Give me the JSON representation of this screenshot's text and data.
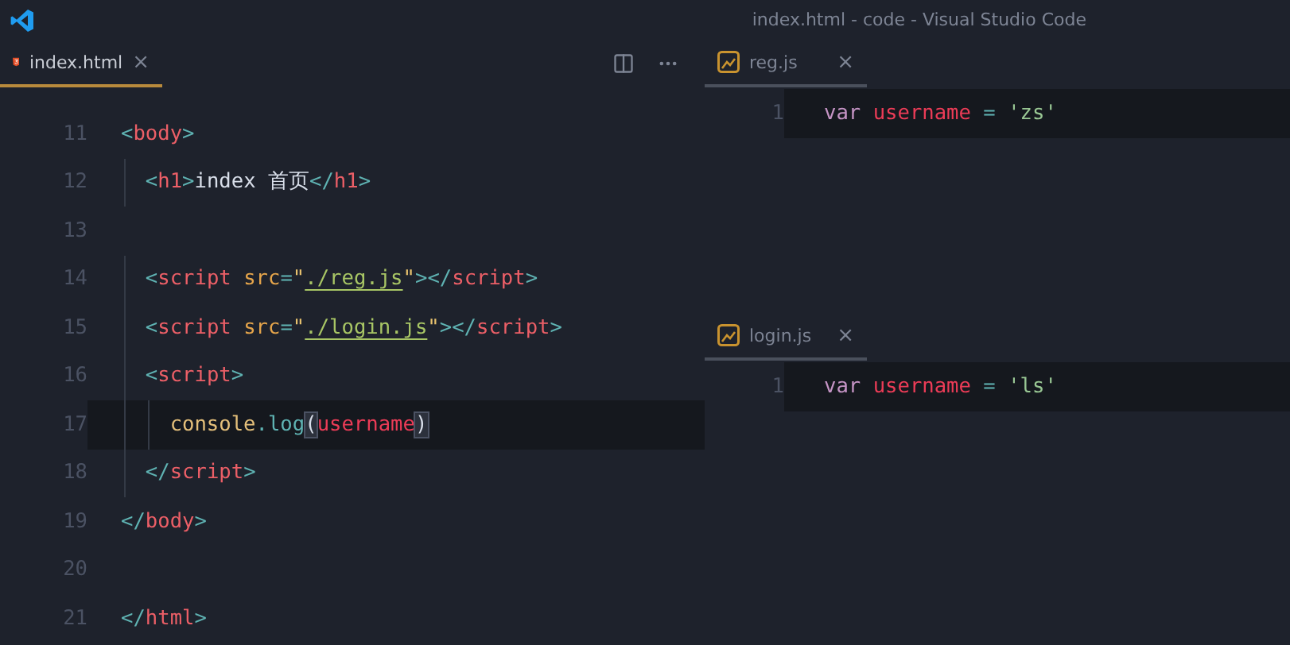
{
  "window": {
    "title": "index.html - code - Visual Studio Code"
  },
  "groups": [
    {
      "focused": true,
      "tab": {
        "label": "index.html",
        "close": "×",
        "selected": true
      },
      "lines": [
        {
          "number": "11",
          "current": false,
          "tokens": [
            {
              "kind": "bracket",
              "text": "<"
            },
            {
              "kind": "tag",
              "text": "body"
            },
            {
              "kind": "bracket",
              "text": ">"
            }
          ]
        },
        {
          "number": "12",
          "current": false,
          "tokens": [
            {
              "kind": "bracket",
              "text": "  <"
            },
            {
              "kind": "tag",
              "text": "h1"
            },
            {
              "kind": "bracket",
              "text": ">"
            },
            {
              "kind": "plain",
              "text": "index 首页"
            },
            {
              "kind": "bracket",
              "text": "</"
            },
            {
              "kind": "tag",
              "text": "h1"
            },
            {
              "kind": "bracket",
              "text": ">"
            }
          ]
        },
        {
          "number": "13",
          "current": false
        },
        {
          "number": "14",
          "current": false,
          "tokens": [
            {
              "kind": "bracket",
              "text": "  <"
            },
            {
              "kind": "tag",
              "text": "script"
            },
            {
              "kind": "attr",
              "text": " src"
            },
            {
              "kind": "bracket",
              "text": "="
            },
            {
              "kind": "quote",
              "text": "\""
            },
            {
              "kind": "link",
              "text": "./reg.js"
            },
            {
              "kind": "quote",
              "text": "\""
            },
            {
              "kind": "bracket",
              "text": "></"
            },
            {
              "kind": "tag",
              "text": "script"
            },
            {
              "kind": "bracket",
              "text": ">"
            }
          ]
        },
        {
          "number": "15",
          "current": false,
          "tokens": [
            {
              "kind": "bracket",
              "text": "  <"
            },
            {
              "kind": "tag",
              "text": "script"
            },
            {
              "kind": "attr",
              "text": " src"
            },
            {
              "kind": "bracket",
              "text": "="
            },
            {
              "kind": "quote",
              "text": "\""
            },
            {
              "kind": "link",
              "text": "./login.js"
            },
            {
              "kind": "quote",
              "text": "\""
            },
            {
              "kind": "bracket",
              "text": "></"
            },
            {
              "kind": "tag",
              "text": "script"
            },
            {
              "kind": "bracket",
              "text": ">"
            }
          ]
        },
        {
          "number": "16",
          "current": false,
          "tokens": [
            {
              "kind": "bracket",
              "text": "  <"
            },
            {
              "kind": "tag",
              "text": "script"
            },
            {
              "kind": "bracket",
              "text": ">"
            }
          ]
        },
        {
          "number": "17",
          "current": true,
          "tokens": [
            {
              "kind": "object",
              "text": "    console"
            },
            {
              "kind": "bracket",
              "text": "."
            },
            {
              "kind": "method",
              "text": "log"
            },
            {
              "kind": "paren",
              "text": "("
            },
            {
              "kind": "variable",
              "text": "username"
            },
            {
              "kind": "paren",
              "text": ")"
            }
          ]
        },
        {
          "number": "18",
          "current": false,
          "tokens": [
            {
              "kind": "bracket",
              "text": "  </"
            },
            {
              "kind": "tag",
              "text": "script"
            },
            {
              "kind": "bracket",
              "text": ">"
            }
          ]
        },
        {
          "number": "19",
          "current": false,
          "tokens": [
            {
              "kind": "bracket",
              "text": "</"
            },
            {
              "kind": "tag",
              "text": "body"
            },
            {
              "kind": "bracket",
              "text": ">"
            }
          ]
        },
        {
          "number": "20",
          "current": false
        },
        {
          "number": "21",
          "current": false,
          "tokens": [
            {
              "kind": "bracket",
              "text": "</"
            },
            {
              "kind": "tag",
              "text": "html"
            },
            {
              "kind": "bracket",
              "text": ">"
            }
          ]
        }
      ]
    },
    {
      "focused": false,
      "tab": {
        "label": "reg.js",
        "close": "×",
        "selected": true
      },
      "lines": [
        {
          "number": "1",
          "current": true,
          "tokens": [
            {
              "kind": "keyword",
              "text": "var"
            },
            {
              "kind": "variable",
              "text": " username"
            },
            {
              "kind": "bracket",
              "text": " ="
            },
            {
              "kind": "string",
              "text": " 'zs'"
            }
          ]
        }
      ]
    },
    {
      "focused": false,
      "tab": {
        "label": "login.js",
        "close": "×",
        "selected": true
      },
      "lines": [
        {
          "number": "1",
          "current": true,
          "tokens": [
            {
              "kind": "keyword",
              "text": "var"
            },
            {
              "kind": "variable",
              "text": " username"
            },
            {
              "kind": "bracket",
              "text": " ="
            },
            {
              "kind": "string",
              "text": " 'ls'"
            }
          ]
        }
      ]
    }
  ]
}
